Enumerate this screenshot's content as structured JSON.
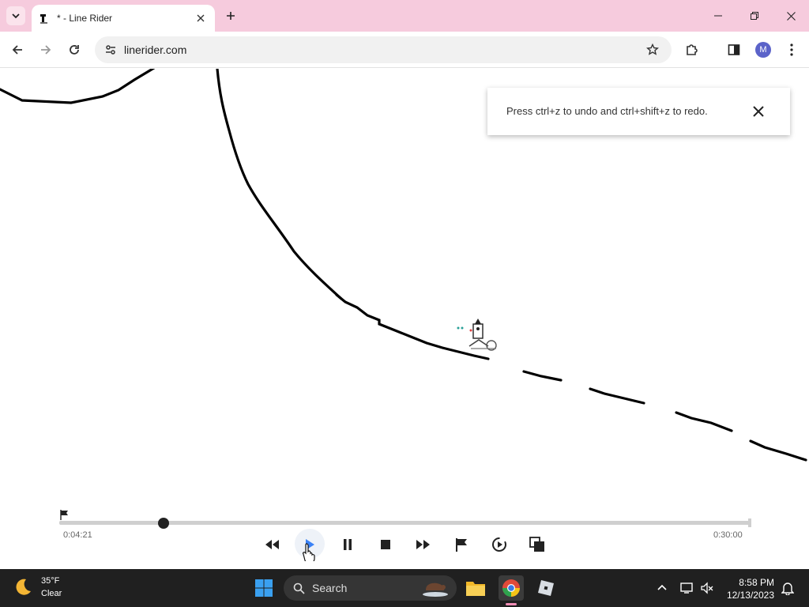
{
  "browser": {
    "tab_title": "* - Line Rider",
    "url": "linerider.com",
    "profile_initial": "M"
  },
  "toast": {
    "message": "Press ctrl+z to undo and ctrl+shift+z to redo."
  },
  "player": {
    "current_time": "0:04:21",
    "end_time": "0:30:00",
    "progress_fraction": 0.151
  },
  "taskbar": {
    "weather_temp": "35°F",
    "weather_condition": "Clear",
    "search_label": "Search",
    "time": "8:58 PM",
    "date": "12/13/2023"
  },
  "colors": {
    "tab_strip": "#f6cbdd",
    "taskbar": "#202020",
    "play_accent": "#3b82f6",
    "windows_blue": "#3aa0f0"
  }
}
